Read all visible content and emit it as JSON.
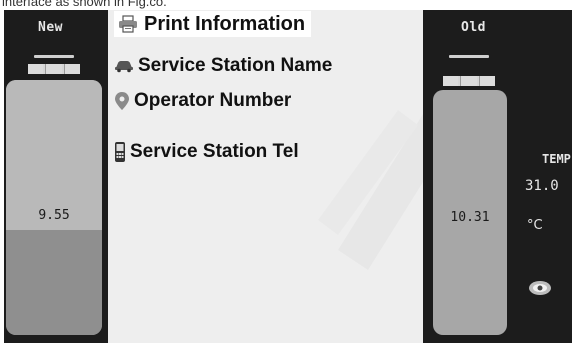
{
  "caption": "interface as shown in Fig.co.",
  "left_panel": {
    "title": "New",
    "value": "9.55",
    "level_fraction": 0.5
  },
  "right_panel": {
    "title": "Old",
    "value": "10.31"
  },
  "menu": {
    "title": "Print Information",
    "items": [
      {
        "label": "Service Station Name",
        "icon": "car-icon"
      },
      {
        "label": "Operator Number",
        "icon": "location-pin-icon"
      },
      {
        "label": "Service Station Tel",
        "icon": "phone-icon"
      }
    ]
  },
  "temperature": {
    "label": "TEMP",
    "value": "31.0",
    "unit": "°C"
  },
  "colors": {
    "screen_bg": "#1a1a1a",
    "menu_bg": "#eeeeee",
    "tube": "#a9a9a9",
    "text_light": "#e6e6e6"
  }
}
